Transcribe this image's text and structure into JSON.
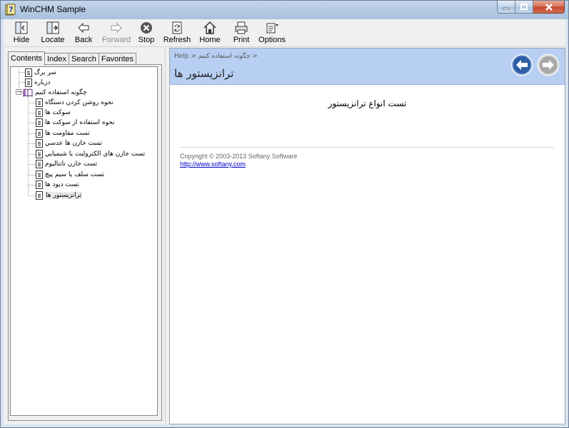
{
  "window": {
    "title": "WinCHM Sample"
  },
  "toolbar": {
    "buttons": [
      {
        "label": "Hide",
        "icon": "hide-icon"
      },
      {
        "label": "Locate",
        "icon": "locate-icon"
      },
      {
        "label": "Back",
        "icon": "back-arrow-icon"
      },
      {
        "label": "Forward",
        "icon": "forward-arrow-icon",
        "disabled": true
      },
      {
        "label": "Stop",
        "icon": "stop-icon"
      },
      {
        "label": "Refresh",
        "icon": "refresh-icon"
      },
      {
        "label": "Home",
        "icon": "home-icon"
      },
      {
        "label": "Print",
        "icon": "printer-icon"
      },
      {
        "label": "Options",
        "icon": "options-icon"
      }
    ]
  },
  "tabs": [
    {
      "label": "Contents",
      "active": true
    },
    {
      "label": "Index"
    },
    {
      "label": "Search"
    },
    {
      "label": "Favorites"
    }
  ],
  "tree": {
    "top_items": [
      "سر برگ",
      "درباره"
    ],
    "folder": "چگونه استفاده کنیم",
    "children": [
      "نحوه روشن کردن دستگاه",
      "سوکت ها",
      "نحوه استفاده از سوکت  ها",
      "تست مقاومت ها",
      "تست خازن ها عدسي",
      "تست خازن هاي الكتروليت يا شيميايي",
      "تست خازن تانتاليوم",
      "تست سلف يا سيم پيچ",
      "تست ديود ها",
      "ترانزيستور ها"
    ],
    "selected": "ترانزيستور ها"
  },
  "content": {
    "breadcrumb_root": "Help",
    "breadcrumb_sep": ">",
    "breadcrumb_item": "چگونه استفاده كنيم",
    "page_title": "ترانزيستور ها",
    "body_text": "تست انواع ترانزيستور",
    "copyright": "Copyright © 2003-2013 Softany Software",
    "link": "http://www.softany.com"
  },
  "colors": {
    "header_band": "#b7cff2",
    "link": "#0000cc",
    "close_button": "#c3462b"
  }
}
